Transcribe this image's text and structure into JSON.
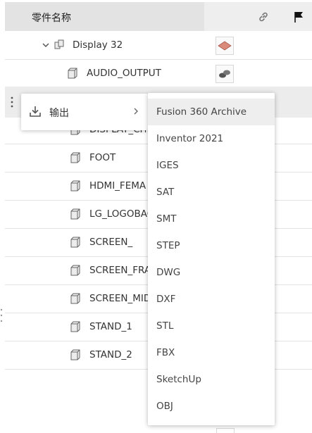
{
  "header": {
    "title": "零件名称"
  },
  "tree": {
    "parent": {
      "label": "Display 32"
    },
    "rows": [
      {
        "label": "AUDIO_OUTPUT"
      },
      {
        "label": "DISPLAY_CH"
      },
      {
        "label": "FOOT"
      },
      {
        "label": "HDMI_FEMA"
      },
      {
        "label": "LG_LOGOBAC"
      },
      {
        "label": "SCREEN_"
      },
      {
        "label": "SCREEN_FRA"
      },
      {
        "label": "SCREEN_MID"
      },
      {
        "label": "STAND_1"
      },
      {
        "label": "STAND_2"
      }
    ]
  },
  "context_menu": {
    "export_label": "输出"
  },
  "export_menu": {
    "items": [
      "Fusion 360 Archive",
      "Inventor 2021",
      "IGES",
      "SAT",
      "SMT",
      "STEP",
      "DWG",
      "DXF",
      "STL",
      "FBX",
      "SketchUp",
      "OBJ"
    ],
    "active_index": 0
  }
}
